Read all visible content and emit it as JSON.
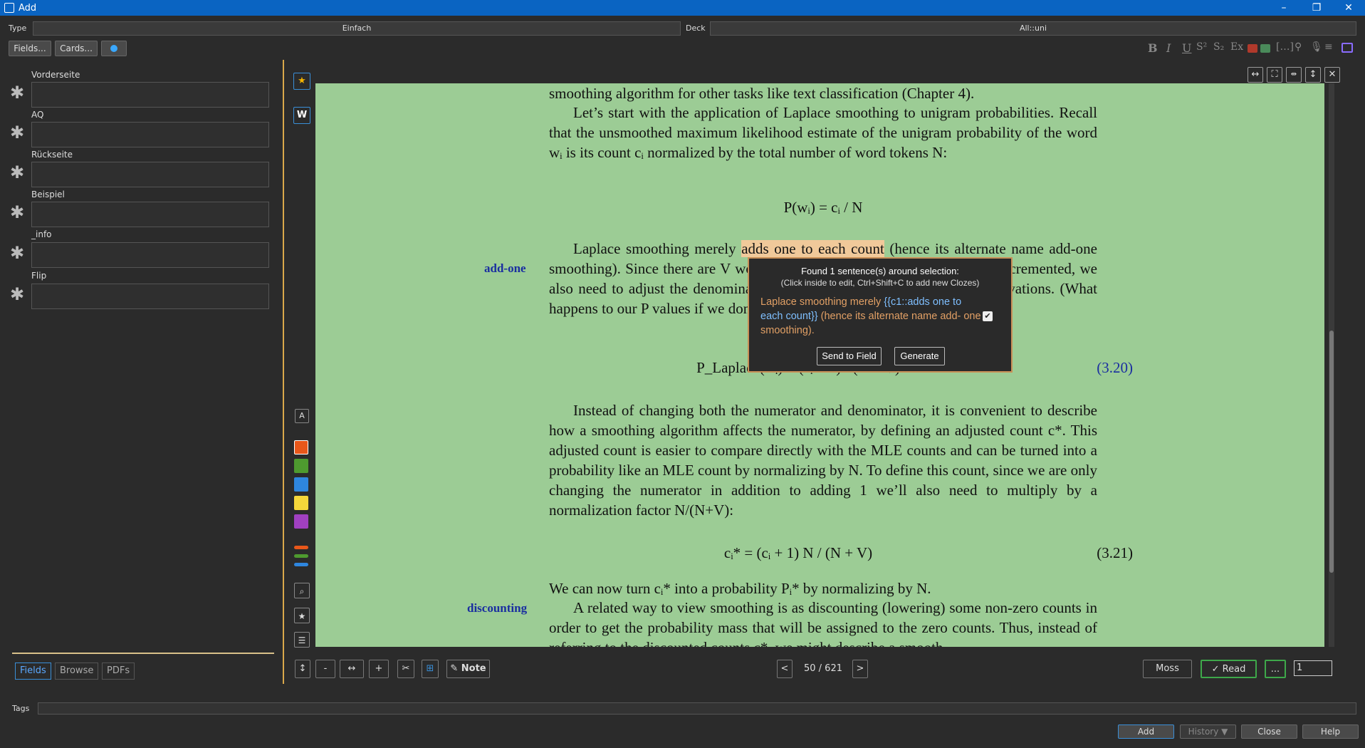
{
  "window": {
    "title": "Add"
  },
  "type_row": {
    "type_label": "Type",
    "type_value": "Einfach",
    "deck_label": "Deck",
    "deck_value": "All::uni"
  },
  "toolbar": {
    "fields_button": "Fields...",
    "cards_button": "Cards..."
  },
  "fields": [
    {
      "label": "Vorderseite"
    },
    {
      "label": "AQ"
    },
    {
      "label": "Rückseite"
    },
    {
      "label": "Beispiel"
    },
    {
      "label": "_info"
    },
    {
      "label": "Flip"
    }
  ],
  "left_tabs": {
    "fields": "Fields",
    "browse": "Browse",
    "pdfs": "PDFs"
  },
  "side_tools": {
    "w_label": "W",
    "a_label": "A"
  },
  "colors": {
    "orange": "#e8571a",
    "green": "#4e9a2f",
    "blue": "#2e86de",
    "yellow": "#f4d63a",
    "purple": "#a040c0"
  },
  "pdf": {
    "para1": "smoothing algorithm for other tasks like text classification (Chapter 4).",
    "para2": "Let’s start with the application of Laplace smoothing to unigram probabilities. Recall that the unsmoothed maximum likelihood estimate of the unigram probability of the word wᵢ is its count cᵢ normalized by the total number of word tokens N:",
    "eq1": "P(wᵢ) = cᵢ / N",
    "para3_pre": "Laplace smoothing merely ",
    "para3_hl": "adds one to each count",
    "para3_post": " (hence its alternate name add-one smoothing). Since there are V words in the vocabulary and each one was incremented, we also need to adjust the denominator to take into account the extra V observations. (What happens to our P values if we don’t increase the denominator?)",
    "margin_addone": "add-one",
    "eq320_num": "(3.20)",
    "eq320_text": "P_Laplace(wᵢ) = (cᵢ + 1) / (N + V)",
    "para4": "Instead of changing both the numerator and denominator, it is convenient to describe how a smoothing algorithm affects the numerator, by defining an adjusted count c*. This adjusted count is easier to compare directly with the MLE counts and can be turned into a probability like an MLE count by normalizing by N. To define this count, since we are only changing the numerator in addition to adding 1 we’ll also need to multiply by a normalization factor N/(N+V):",
    "eq321_text": "cᵢ* = (cᵢ + 1) N / (N + V)",
    "eq321_num": "(3.21)",
    "para5": "We can now turn cᵢ* into a probability Pᵢ* by normalizing by N.",
    "margin_discounting": "discounting",
    "para6": "A related way to view smoothing is as discounting (lowering) some non-zero counts in order to get the probability mass that will be assigned to the zero counts. Thus, instead of referring to the discounted counts c*, we might describe a smooth-"
  },
  "popup": {
    "title": "Found 1 sentence(s) around selection:",
    "subtitle": "(Click inside to edit, Ctrl+Shift+C to add new Clozes)",
    "sentence_pre": "Laplace smoothing merely ",
    "sentence_cloze": "{{c1::adds one to each count}}",
    "sentence_post": " (hence its alternate name add- one smoothing).",
    "send_button": "Send to Field",
    "generate_button": "Generate"
  },
  "bottom_bar": {
    "minus": "-",
    "plus": "+",
    "note_button": "Note",
    "prev": "<",
    "page": "50 / 621",
    "next": ">",
    "moss_button": "Moss",
    "read_button": "✓ Read",
    "more_button": "...",
    "page_input": "1"
  },
  "tags": {
    "label": "Tags"
  },
  "footer": {
    "add": "Add",
    "history": "History ▼",
    "close": "Close",
    "help": "Help"
  }
}
